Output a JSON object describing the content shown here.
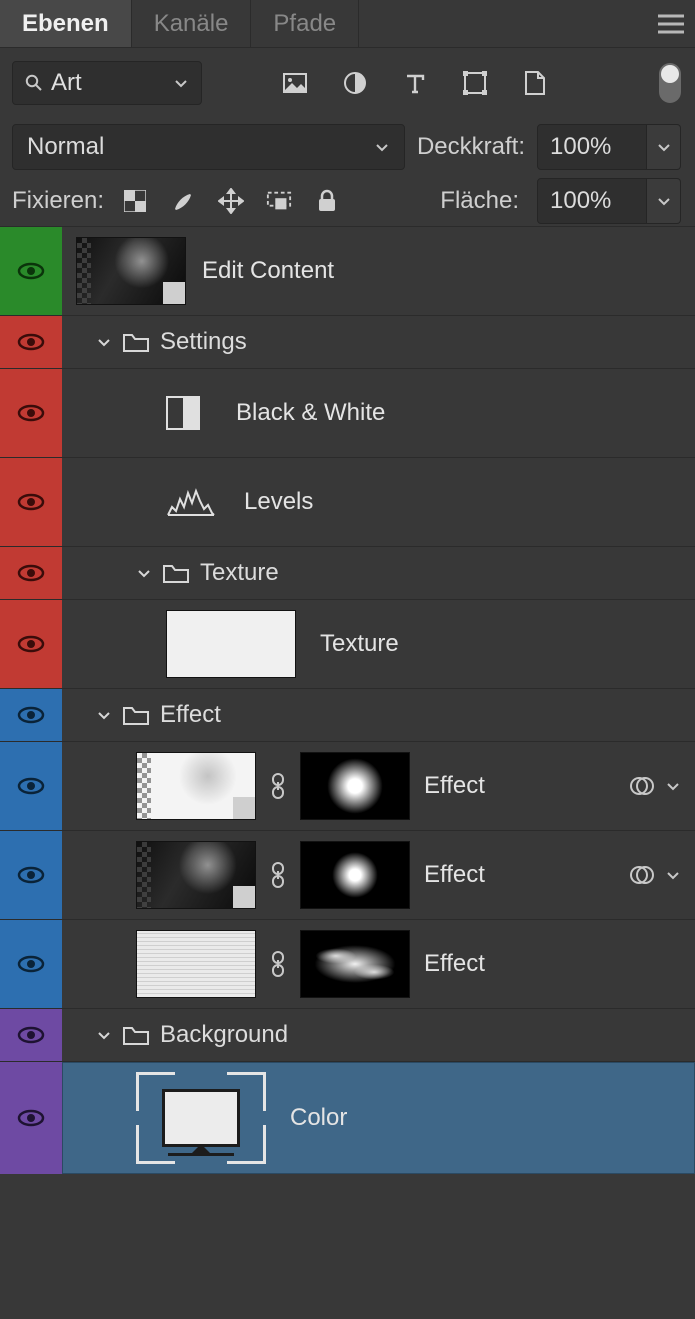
{
  "tabs": {
    "layers": "Ebenen",
    "channels": "Kanäle",
    "paths": "Pfade"
  },
  "filter": {
    "placeholder": "Art"
  },
  "blend": {
    "mode": "Normal"
  },
  "opacity": {
    "label": "Deckkraft:",
    "value": "100%"
  },
  "lock": {
    "label": "Fixieren:"
  },
  "fill": {
    "label": "Fläche:",
    "value": "100%"
  },
  "layers": {
    "edit_content": "Edit Content",
    "settings_group": "Settings",
    "black_white": "Black & White",
    "levels": "Levels",
    "texture_group": "Texture",
    "texture_layer": "Texture",
    "effect_group": "Effect",
    "effect_1": "Effect",
    "effect_2": "Effect",
    "effect_3": "Effect",
    "background_group": "Background",
    "color_layer": "Color"
  }
}
